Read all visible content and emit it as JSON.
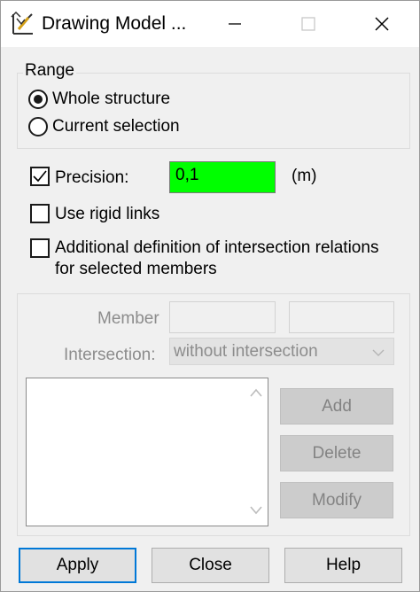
{
  "window": {
    "title": "Drawing Model ..."
  },
  "titlebar_icons": {
    "app": "drawing-model-icon",
    "minimize": "minimize-icon",
    "maximize": "maximize-icon",
    "close": "close-icon"
  },
  "range": {
    "label": "Range",
    "options": [
      {
        "label": "Whole structure",
        "checked": true
      },
      {
        "label": "Current selection",
        "checked": false
      }
    ]
  },
  "precision": {
    "checked": true,
    "label": "Precision:",
    "value": "0,1",
    "unit": "(m)",
    "highlight_color": "#00ff00"
  },
  "rigid_links": {
    "checked": false,
    "label": "Use rigid links"
  },
  "additional": {
    "checked": false,
    "label_line1": "Additional definition of intersection relations",
    "label_line2": "for selected members"
  },
  "member_section": {
    "member_label": "Member",
    "member_value_1": "",
    "member_value_2": "",
    "intersection_label": "Intersection:",
    "intersection_value": "without intersection",
    "add_label": "Add",
    "delete_label": "Delete",
    "modify_label": "Modify"
  },
  "footer": {
    "apply_label": "Apply",
    "close_label": "Close",
    "help_label": "Help"
  }
}
